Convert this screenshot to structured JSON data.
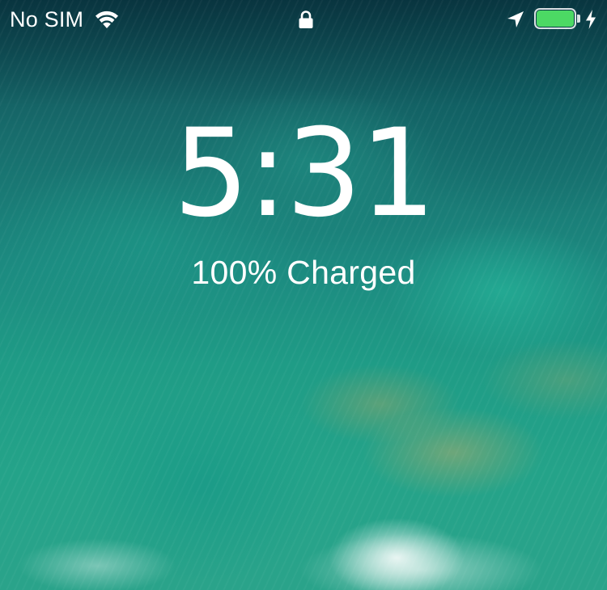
{
  "status_bar": {
    "carrier": "No SIM",
    "wifi_icon": "wifi-icon",
    "lock_icon": "lock-icon",
    "location_icon": "location-arrow-icon",
    "battery_level": 1.0,
    "battery_color": "#4cd964",
    "charging_icon": "lightning-bolt-icon"
  },
  "lock_screen": {
    "time": "5:31",
    "charge_status": "100% Charged"
  },
  "colors": {
    "text": "#ffffff",
    "battery_fill": "#4cd964"
  }
}
